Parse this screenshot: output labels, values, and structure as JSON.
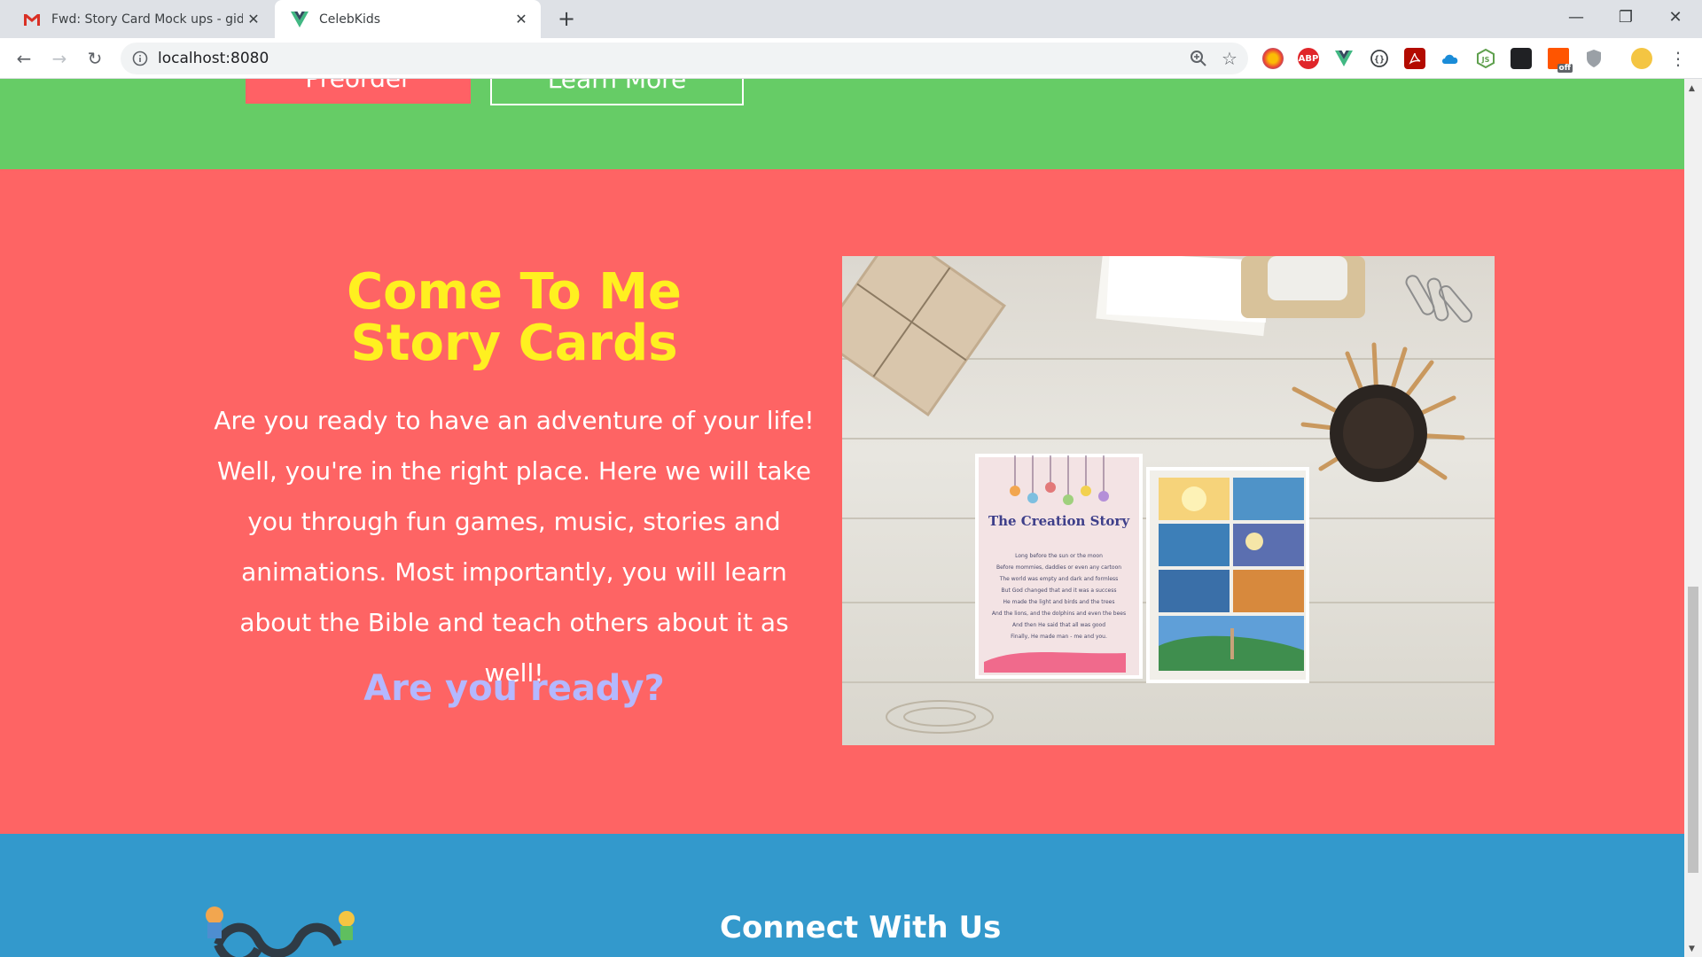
{
  "browser": {
    "tabs": [
      {
        "label": "Fwd: Story Card Mock ups - gide",
        "icon": "gmail-icon"
      },
      {
        "label": "CelebKids",
        "icon": "vue-icon"
      }
    ],
    "new_tab": "+",
    "url": "localhost:8080",
    "extensions": [
      "ABP",
      "off"
    ]
  },
  "hero": {
    "preorder_label": "Preorder",
    "learn_more_label": "Learn More"
  },
  "story": {
    "title_line1": "Come To Me",
    "title_line2": "Story Cards",
    "body": "Are you ready to have an adventure of your life! Well, you're in the right place. Here we will take you through fun games, music, stories and animations. Most importantly, you will learn about the Bible and teach others about it as well!",
    "cta": "Are you ready?",
    "card_title": "The Creation Story",
    "card_lines": [
      "Long before the sun or the moon",
      "Before mommies, daddies or even any cartoon",
      "The world was empty and dark and formless",
      "But God changed that and it was a success",
      "He made the light and birds and the trees",
      "And the lions, and the dolphins and even the bees",
      "And then He said that all was good",
      "Finally, He made man - me and you."
    ]
  },
  "footer": {
    "connect_title": "Connect With Us"
  },
  "colors": {
    "green": "#66cc66",
    "coral": "#fe6464",
    "yellow": "#fff020",
    "lavender": "#b4b8ff",
    "blue": "#3399cc"
  }
}
